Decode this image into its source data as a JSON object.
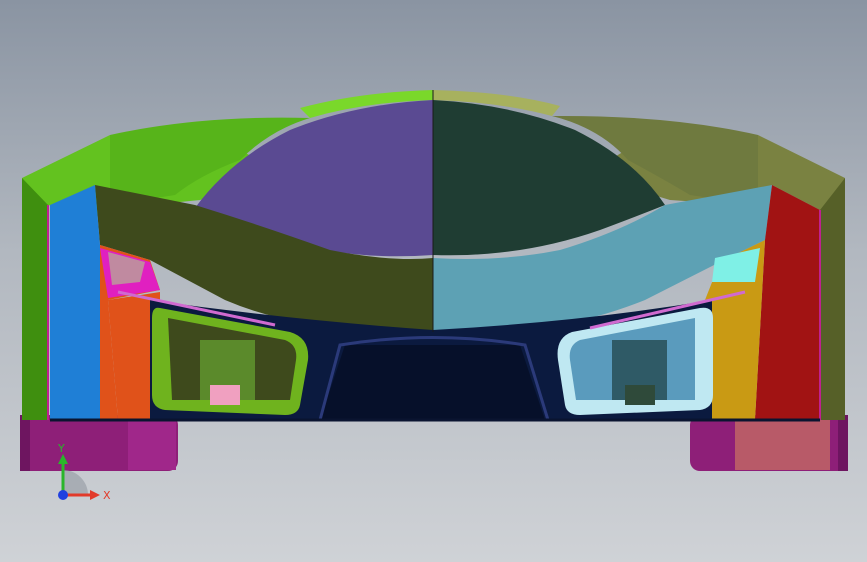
{
  "viewport": {
    "background_top": "#8a94a2",
    "background_bottom": "#cfd2d6"
  },
  "model": {
    "description_icon": "car-rear-view-icon",
    "colors": {
      "left_green": "#63c21f",
      "right_olive": "#6f7a3f",
      "canopy_left": "#5a4a92",
      "canopy_right": "#1f3d33",
      "deck_left": "#3e4a1c",
      "deck_right": "#5da1b4",
      "diffuser": "#0b1a3f",
      "left_blue": "#1f7fd6",
      "left_orange": "#e0521a",
      "right_red": "#a11313",
      "right_gold": "#c99a14",
      "tire_left": "#8e1f78",
      "tire_right": "#b85a68"
    }
  },
  "triad": {
    "x_label": "X",
    "y_label": "Y",
    "x_color": "#e23a2a",
    "y_color": "#2ab52a",
    "origin_color": "#2040e0"
  }
}
